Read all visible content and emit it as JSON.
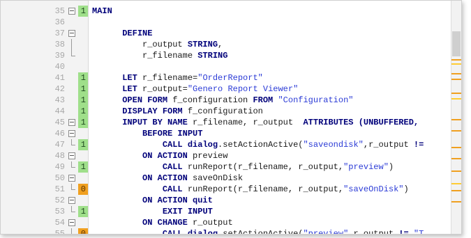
{
  "lines": [
    {
      "num": "35",
      "fold": "box",
      "cov": "1",
      "covType": "green",
      "segs": [
        {
          "t": "",
          "c": "norm"
        },
        {
          "t": "MAIN",
          "c": "kw"
        }
      ]
    },
    {
      "num": "36",
      "fold": "none",
      "cov": "",
      "covType": "",
      "segs": []
    },
    {
      "num": "37",
      "fold": "box",
      "cov": "",
      "covType": "",
      "segs": [
        {
          "t": "      ",
          "c": "norm"
        },
        {
          "t": "DEFINE",
          "c": "kw"
        }
      ]
    },
    {
      "num": "38",
      "fold": "line",
      "cov": "",
      "covType": "",
      "segs": [
        {
          "t": "          r_output ",
          "c": "norm"
        },
        {
          "t": "STRING",
          "c": "kw"
        },
        {
          "t": ",",
          "c": "norm"
        }
      ]
    },
    {
      "num": "39",
      "fold": "end",
      "cov": "",
      "covType": "",
      "segs": [
        {
          "t": "          r_filename ",
          "c": "norm"
        },
        {
          "t": "STRING",
          "c": "kw"
        }
      ]
    },
    {
      "num": "40",
      "fold": "none",
      "cov": "",
      "covType": "",
      "segs": []
    },
    {
      "num": "41",
      "fold": "none",
      "cov": "1",
      "covType": "green",
      "segs": [
        {
          "t": "      ",
          "c": "norm"
        },
        {
          "t": "LET",
          "c": "kw"
        },
        {
          "t": " r_filename=",
          "c": "norm"
        },
        {
          "t": "\"OrderReport\"",
          "c": "str"
        }
      ]
    },
    {
      "num": "42",
      "fold": "none",
      "cov": "1",
      "covType": "green",
      "segs": [
        {
          "t": "      ",
          "c": "norm"
        },
        {
          "t": "LET",
          "c": "kw"
        },
        {
          "t": " r_output=",
          "c": "norm"
        },
        {
          "t": "\"Genero Report Viewer\"",
          "c": "str"
        }
      ]
    },
    {
      "num": "43",
      "fold": "none",
      "cov": "1",
      "covType": "green",
      "segs": [
        {
          "t": "      ",
          "c": "norm"
        },
        {
          "t": "OPEN FORM",
          "c": "kw"
        },
        {
          "t": " f_configuration ",
          "c": "norm"
        },
        {
          "t": "FROM",
          "c": "kw"
        },
        {
          "t": " ",
          "c": "norm"
        },
        {
          "t": "\"Configuration\"",
          "c": "str"
        }
      ]
    },
    {
      "num": "44",
      "fold": "none",
      "cov": "1",
      "covType": "green",
      "segs": [
        {
          "t": "      ",
          "c": "norm"
        },
        {
          "t": "DISPLAY FORM",
          "c": "kw"
        },
        {
          "t": " f_configuration",
          "c": "norm"
        }
      ]
    },
    {
      "num": "45",
      "fold": "box",
      "cov": "1",
      "covType": "green",
      "segs": [
        {
          "t": "      ",
          "c": "norm"
        },
        {
          "t": "INPUT BY NAME",
          "c": "kw"
        },
        {
          "t": " r_filename, r_output  ",
          "c": "norm"
        },
        {
          "t": "ATTRIBUTES (UNBUFFERED,",
          "c": "kw"
        }
      ]
    },
    {
      "num": "46",
      "fold": "box",
      "cov": "",
      "covType": "",
      "segs": [
        {
          "t": "          ",
          "c": "norm"
        },
        {
          "t": "BEFORE INPUT",
          "c": "kw"
        }
      ]
    },
    {
      "num": "47",
      "fold": "end",
      "cov": "1",
      "covType": "green",
      "segs": [
        {
          "t": "              ",
          "c": "norm"
        },
        {
          "t": "CALL dialog",
          "c": "kw"
        },
        {
          "t": ".setActionActive(",
          "c": "norm"
        },
        {
          "t": "\"saveondisk\"",
          "c": "str"
        },
        {
          "t": ",r_output ",
          "c": "norm"
        },
        {
          "t": "!=",
          "c": "kw"
        }
      ]
    },
    {
      "num": "48",
      "fold": "box",
      "cov": "",
      "covType": "",
      "segs": [
        {
          "t": "          ",
          "c": "norm"
        },
        {
          "t": "ON ACTION",
          "c": "kw"
        },
        {
          "t": " preview",
          "c": "norm"
        }
      ]
    },
    {
      "num": "49",
      "fold": "end",
      "cov": "1",
      "covType": "green",
      "segs": [
        {
          "t": "              ",
          "c": "norm"
        },
        {
          "t": "CALL",
          "c": "kw"
        },
        {
          "t": " runReport(r_filename, r_output,",
          "c": "norm"
        },
        {
          "t": "\"preview\"",
          "c": "str"
        },
        {
          "t": ")",
          "c": "norm"
        }
      ]
    },
    {
      "num": "50",
      "fold": "box",
      "cov": "",
      "covType": "",
      "segs": [
        {
          "t": "          ",
          "c": "norm"
        },
        {
          "t": "ON ACTION",
          "c": "kw"
        },
        {
          "t": " saveOnDisk",
          "c": "norm"
        }
      ]
    },
    {
      "num": "51",
      "fold": "end",
      "cov": "0",
      "covType": "orange",
      "segs": [
        {
          "t": "              ",
          "c": "norm"
        },
        {
          "t": "CALL",
          "c": "kw"
        },
        {
          "t": " runReport(r_filename, r_output,",
          "c": "norm"
        },
        {
          "t": "\"saveOnDisk\"",
          "c": "str"
        },
        {
          "t": ")",
          "c": "norm"
        }
      ]
    },
    {
      "num": "52",
      "fold": "box",
      "cov": "",
      "covType": "",
      "segs": [
        {
          "t": "          ",
          "c": "norm"
        },
        {
          "t": "ON ACTION quit",
          "c": "kw"
        }
      ]
    },
    {
      "num": "53",
      "fold": "end",
      "cov": "1",
      "covType": "green",
      "segs": [
        {
          "t": "              ",
          "c": "norm"
        },
        {
          "t": "EXIT INPUT",
          "c": "kw"
        }
      ]
    },
    {
      "num": "54",
      "fold": "box",
      "cov": "",
      "covType": "",
      "segs": [
        {
          "t": "          ",
          "c": "norm"
        },
        {
          "t": "ON CHANGE",
          "c": "kw"
        },
        {
          "t": " r_output",
          "c": "norm"
        }
      ]
    },
    {
      "num": "55",
      "fold": "end",
      "cov": "0",
      "covType": "orange",
      "segs": [
        {
          "t": "              ",
          "c": "norm"
        },
        {
          "t": "CALL dialog",
          "c": "kw"
        },
        {
          "t": ".setActionActive(",
          "c": "norm"
        },
        {
          "t": "\"preview\"",
          "c": "str"
        },
        {
          "t": ",r_output ",
          "c": "norm"
        },
        {
          "t": "!=",
          "c": "kw"
        },
        {
          "t": " ",
          "c": "norm"
        },
        {
          "t": "\"T",
          "c": "str"
        }
      ]
    }
  ],
  "scrollbar": {
    "marks": [
      {
        "type": "orange"
      },
      {
        "type": "yellow"
      },
      {
        "type": "orange"
      },
      {
        "type": "orange"
      },
      {
        "type": "orange"
      },
      {
        "type": "yellow"
      },
      {
        "type": "orange"
      },
      {
        "type": "orange"
      },
      {
        "type": "orange"
      },
      {
        "type": "orange"
      },
      {
        "type": "orange"
      },
      {
        "type": "yellow"
      },
      {
        "type": "orange"
      },
      {
        "type": "orange"
      }
    ]
  }
}
